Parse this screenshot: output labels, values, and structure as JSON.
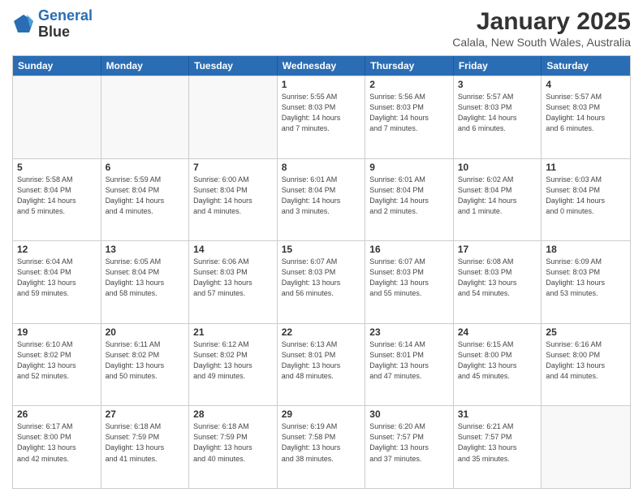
{
  "header": {
    "logo_line1": "General",
    "logo_line2": "Blue",
    "title": "January 2025",
    "subtitle": "Calala, New South Wales, Australia"
  },
  "days_of_week": [
    "Sunday",
    "Monday",
    "Tuesday",
    "Wednesday",
    "Thursday",
    "Friday",
    "Saturday"
  ],
  "weeks": [
    [
      {
        "day": "",
        "empty": true,
        "text": ""
      },
      {
        "day": "",
        "empty": true,
        "text": ""
      },
      {
        "day": "",
        "empty": true,
        "text": ""
      },
      {
        "day": "1",
        "empty": false,
        "text": "Sunrise: 5:55 AM\nSunset: 8:03 PM\nDaylight: 14 hours\nand 7 minutes."
      },
      {
        "day": "2",
        "empty": false,
        "text": "Sunrise: 5:56 AM\nSunset: 8:03 PM\nDaylight: 14 hours\nand 7 minutes."
      },
      {
        "day": "3",
        "empty": false,
        "text": "Sunrise: 5:57 AM\nSunset: 8:03 PM\nDaylight: 14 hours\nand 6 minutes."
      },
      {
        "day": "4",
        "empty": false,
        "text": "Sunrise: 5:57 AM\nSunset: 8:03 PM\nDaylight: 14 hours\nand 6 minutes."
      }
    ],
    [
      {
        "day": "5",
        "empty": false,
        "text": "Sunrise: 5:58 AM\nSunset: 8:04 PM\nDaylight: 14 hours\nand 5 minutes."
      },
      {
        "day": "6",
        "empty": false,
        "text": "Sunrise: 5:59 AM\nSunset: 8:04 PM\nDaylight: 14 hours\nand 4 minutes."
      },
      {
        "day": "7",
        "empty": false,
        "text": "Sunrise: 6:00 AM\nSunset: 8:04 PM\nDaylight: 14 hours\nand 4 minutes."
      },
      {
        "day": "8",
        "empty": false,
        "text": "Sunrise: 6:01 AM\nSunset: 8:04 PM\nDaylight: 14 hours\nand 3 minutes."
      },
      {
        "day": "9",
        "empty": false,
        "text": "Sunrise: 6:01 AM\nSunset: 8:04 PM\nDaylight: 14 hours\nand 2 minutes."
      },
      {
        "day": "10",
        "empty": false,
        "text": "Sunrise: 6:02 AM\nSunset: 8:04 PM\nDaylight: 14 hours\nand 1 minute."
      },
      {
        "day": "11",
        "empty": false,
        "text": "Sunrise: 6:03 AM\nSunset: 8:04 PM\nDaylight: 14 hours\nand 0 minutes."
      }
    ],
    [
      {
        "day": "12",
        "empty": false,
        "text": "Sunrise: 6:04 AM\nSunset: 8:04 PM\nDaylight: 13 hours\nand 59 minutes."
      },
      {
        "day": "13",
        "empty": false,
        "text": "Sunrise: 6:05 AM\nSunset: 8:04 PM\nDaylight: 13 hours\nand 58 minutes."
      },
      {
        "day": "14",
        "empty": false,
        "text": "Sunrise: 6:06 AM\nSunset: 8:03 PM\nDaylight: 13 hours\nand 57 minutes."
      },
      {
        "day": "15",
        "empty": false,
        "text": "Sunrise: 6:07 AM\nSunset: 8:03 PM\nDaylight: 13 hours\nand 56 minutes."
      },
      {
        "day": "16",
        "empty": false,
        "text": "Sunrise: 6:07 AM\nSunset: 8:03 PM\nDaylight: 13 hours\nand 55 minutes."
      },
      {
        "day": "17",
        "empty": false,
        "text": "Sunrise: 6:08 AM\nSunset: 8:03 PM\nDaylight: 13 hours\nand 54 minutes."
      },
      {
        "day": "18",
        "empty": false,
        "text": "Sunrise: 6:09 AM\nSunset: 8:03 PM\nDaylight: 13 hours\nand 53 minutes."
      }
    ],
    [
      {
        "day": "19",
        "empty": false,
        "text": "Sunrise: 6:10 AM\nSunset: 8:02 PM\nDaylight: 13 hours\nand 52 minutes."
      },
      {
        "day": "20",
        "empty": false,
        "text": "Sunrise: 6:11 AM\nSunset: 8:02 PM\nDaylight: 13 hours\nand 50 minutes."
      },
      {
        "day": "21",
        "empty": false,
        "text": "Sunrise: 6:12 AM\nSunset: 8:02 PM\nDaylight: 13 hours\nand 49 minutes."
      },
      {
        "day": "22",
        "empty": false,
        "text": "Sunrise: 6:13 AM\nSunset: 8:01 PM\nDaylight: 13 hours\nand 48 minutes."
      },
      {
        "day": "23",
        "empty": false,
        "text": "Sunrise: 6:14 AM\nSunset: 8:01 PM\nDaylight: 13 hours\nand 47 minutes."
      },
      {
        "day": "24",
        "empty": false,
        "text": "Sunrise: 6:15 AM\nSunset: 8:00 PM\nDaylight: 13 hours\nand 45 minutes."
      },
      {
        "day": "25",
        "empty": false,
        "text": "Sunrise: 6:16 AM\nSunset: 8:00 PM\nDaylight: 13 hours\nand 44 minutes."
      }
    ],
    [
      {
        "day": "26",
        "empty": false,
        "text": "Sunrise: 6:17 AM\nSunset: 8:00 PM\nDaylight: 13 hours\nand 42 minutes."
      },
      {
        "day": "27",
        "empty": false,
        "text": "Sunrise: 6:18 AM\nSunset: 7:59 PM\nDaylight: 13 hours\nand 41 minutes."
      },
      {
        "day": "28",
        "empty": false,
        "text": "Sunrise: 6:18 AM\nSunset: 7:59 PM\nDaylight: 13 hours\nand 40 minutes."
      },
      {
        "day": "29",
        "empty": false,
        "text": "Sunrise: 6:19 AM\nSunset: 7:58 PM\nDaylight: 13 hours\nand 38 minutes."
      },
      {
        "day": "30",
        "empty": false,
        "text": "Sunrise: 6:20 AM\nSunset: 7:57 PM\nDaylight: 13 hours\nand 37 minutes."
      },
      {
        "day": "31",
        "empty": false,
        "text": "Sunrise: 6:21 AM\nSunset: 7:57 PM\nDaylight: 13 hours\nand 35 minutes."
      },
      {
        "day": "",
        "empty": true,
        "text": ""
      }
    ]
  ]
}
